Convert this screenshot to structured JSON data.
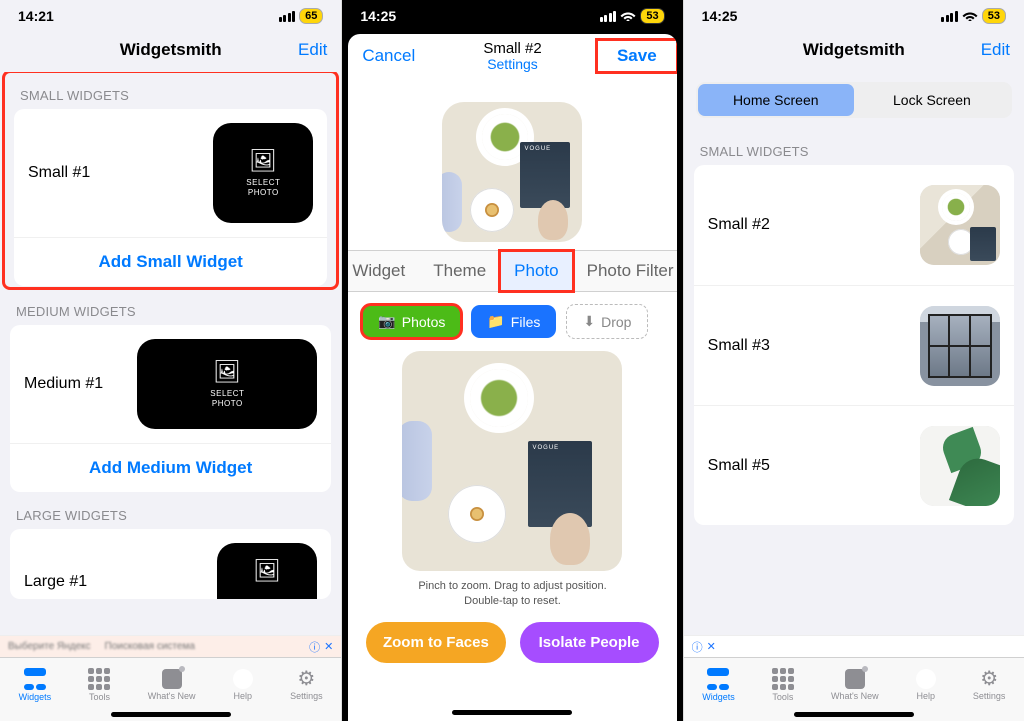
{
  "left": {
    "time": "14:21",
    "battery": "65",
    "title": "Widgetsmith",
    "edit": "Edit",
    "sections": {
      "small": {
        "header": "SMALL WIDGETS",
        "item": "Small #1",
        "add": "Add Small Widget",
        "preview_caption": "SELECT\nPHOTO"
      },
      "medium": {
        "header": "MEDIUM WIDGETS",
        "item": "Medium #1",
        "add": "Add Medium Widget",
        "preview_caption": "SELECT\nPHOTO"
      },
      "large": {
        "header": "LARGE WIDGETS",
        "item": "Large #1"
      }
    },
    "tabs": [
      "Widgets",
      "Tools",
      "What's New",
      "Help",
      "Settings"
    ]
  },
  "mid": {
    "time": "14:25",
    "battery": "53",
    "cancel": "Cancel",
    "save": "Save",
    "title": "Small #2",
    "subtitle": "Settings",
    "tabs": [
      "Widget",
      "Theme",
      "Photo",
      "Photo Filter"
    ],
    "active_tab": "Photo",
    "buttons": {
      "photos": "Photos",
      "files": "Files",
      "drop": "Drop"
    },
    "hint1": "Pinch to zoom. Drag to adjust position.",
    "hint2": "Double-tap to reset.",
    "zoom": "Zoom to Faces",
    "isolate": "Isolate People"
  },
  "right": {
    "time": "14:25",
    "battery": "53",
    "title": "Widgetsmith",
    "edit": "Edit",
    "seg": {
      "home": "Home Screen",
      "lock": "Lock Screen"
    },
    "small_header": "SMALL WIDGETS",
    "items": [
      "Small #2",
      "Small #3",
      "Small #5"
    ],
    "tabs": [
      "Widgets",
      "Tools",
      "What's New",
      "Help",
      "Settings"
    ]
  },
  "ad": {
    "info_icon": "ⓘ",
    "close_icon": "✕"
  }
}
